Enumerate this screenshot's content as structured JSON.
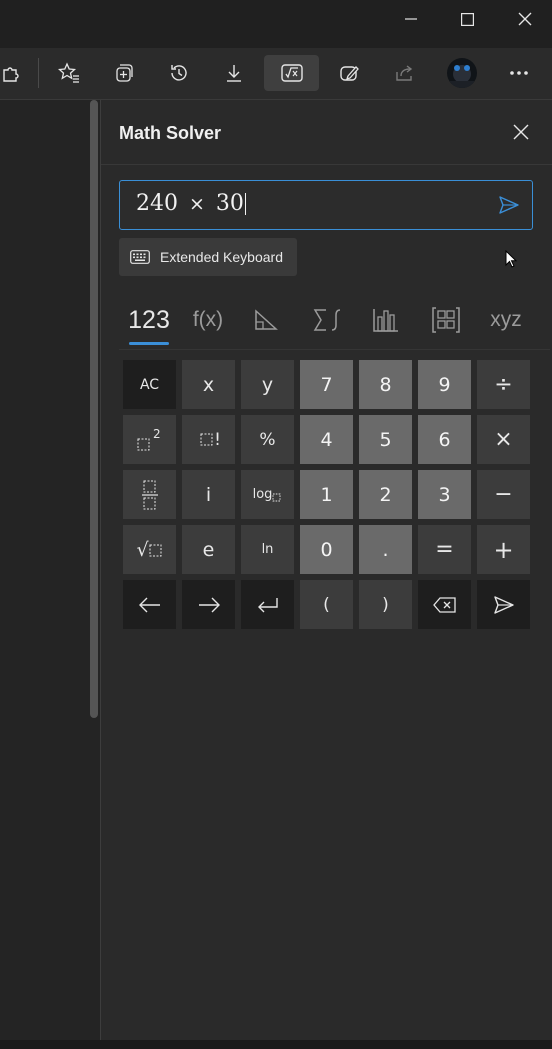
{
  "window": {
    "controls": [
      {
        "name": "minimize-icon"
      },
      {
        "name": "maximize-icon"
      },
      {
        "name": "close-icon"
      }
    ]
  },
  "toolbar": {
    "icons": [
      "extensions-icon",
      "favorites-icon",
      "collections-icon",
      "history-icon",
      "downloads-icon",
      "math-solver-icon",
      "web-capture-icon",
      "share-icon",
      "profile-avatar",
      "more-icon"
    ],
    "active": "math-solver-icon"
  },
  "panel": {
    "title": "Math Solver",
    "input": {
      "value_a": "240",
      "operator": "×",
      "value_b": "30"
    },
    "extended_keyboard_label": "Extended Keyboard"
  },
  "tabs": [
    {
      "label": "123",
      "active": true
    },
    {
      "label": "f(x)",
      "active": false
    },
    {
      "icon": "triangle-icon",
      "active": false
    },
    {
      "icon": "sum-integral-icon",
      "active": false
    },
    {
      "icon": "bar-chart-icon",
      "active": false
    },
    {
      "icon": "matrix-icon",
      "active": false
    },
    {
      "label": "xyz",
      "active": false
    }
  ],
  "keypad": {
    "row1": [
      "AC",
      "x",
      "y",
      "7",
      "8",
      "9",
      "÷"
    ],
    "row2": [
      "□²",
      "□!",
      "%",
      "4",
      "5",
      "6",
      "×"
    ],
    "row3": [
      "fraction",
      "i",
      "log□",
      "1",
      "2",
      "3",
      "−"
    ],
    "row4": [
      "√□",
      "e",
      "ln",
      "0",
      ".",
      "=",
      "+"
    ],
    "row5": [
      "←",
      "→",
      "↵",
      "(",
      ")",
      "⌫",
      "send"
    ],
    "labels": {
      "ac": "AC",
      "x": "x",
      "y": "y",
      "seven": "7",
      "eight": "8",
      "nine": "9",
      "divide": "÷",
      "percent": "%",
      "four": "4",
      "five": "5",
      "six": "6",
      "multiply": "×",
      "i": "i",
      "one": "1",
      "two": "2",
      "three": "3",
      "minus": "−",
      "e": "e",
      "ln": "ln",
      "zero": "0",
      "dot": ".",
      "equals": "=",
      "plus": "+",
      "open_paren": "(",
      "close_paren": ")",
      "log": "log",
      "factorial": "!",
      "sqrt": "√"
    }
  },
  "colors": {
    "accent": "#3b8fd8",
    "background": "#2a2a2a"
  }
}
